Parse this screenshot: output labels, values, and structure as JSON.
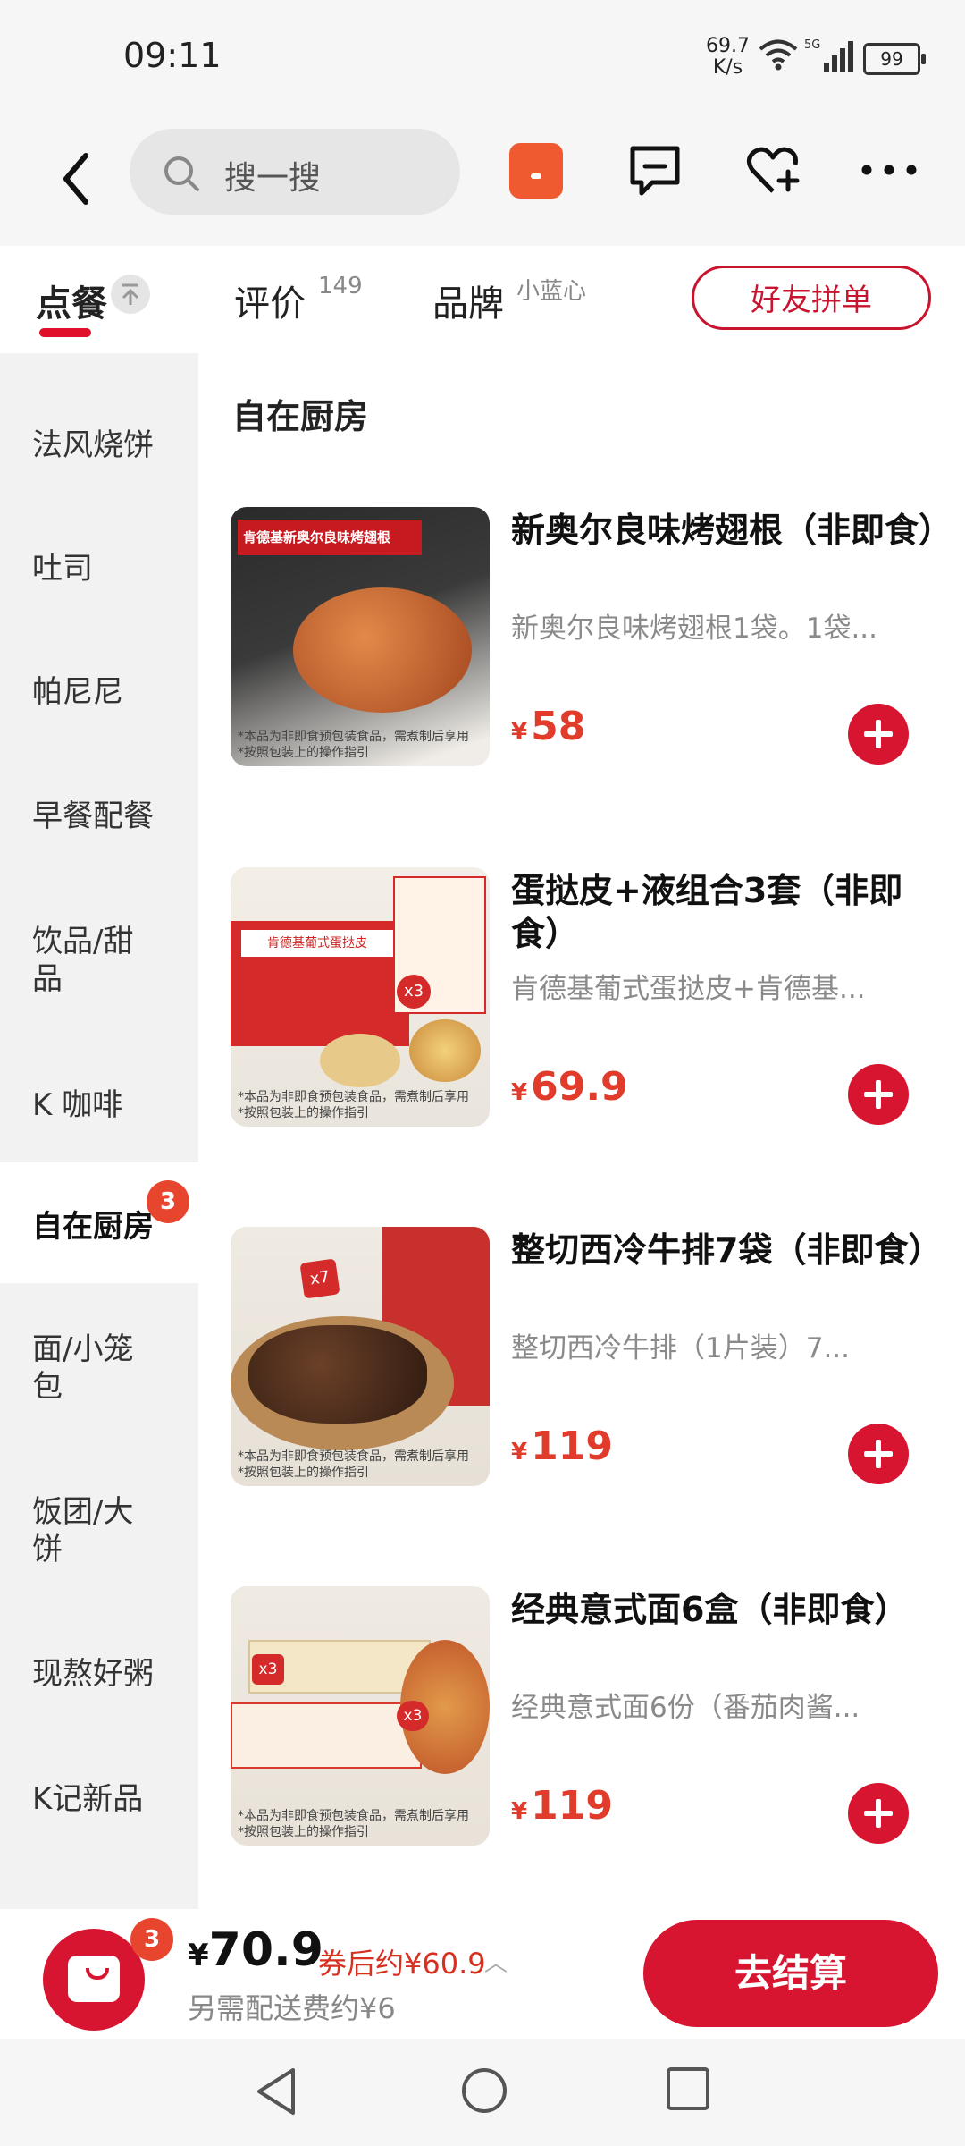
{
  "status": {
    "time": "09:11",
    "speed_value": "69.7",
    "speed_unit": "K/s",
    "network": "5G",
    "battery": "99"
  },
  "header": {
    "search_placeholder": "搜一搜"
  },
  "tabs": [
    {
      "label": "点餐",
      "active": true
    },
    {
      "label": "评价",
      "count": "149"
    },
    {
      "label": "品牌",
      "sub": "小蓝心"
    }
  ],
  "group_order_button": "好友拼单",
  "sidebar": {
    "categories": [
      "法风烧饼",
      "吐司",
      "帕尼尼",
      "早餐配餐",
      "饮品/甜品",
      "K 咖啡",
      "自在厨房",
      "面/小笼包",
      "饭团/大饼",
      "现熬好粥",
      "K记新品"
    ],
    "active_index": 6,
    "active_badge": "3"
  },
  "section_title": "自在厨房",
  "products": [
    {
      "name": "新奥尔良味烤翅根（非即食）",
      "desc": "新奥尔良味烤翅根1袋。1袋...",
      "currency": "¥",
      "price": "58",
      "image_title": "肯德基新奥尔良味烤翅根",
      "image_note": "*本品为非即食预包装食品，需煮制后享用",
      "image_note2": "*按照包装上的操作指引"
    },
    {
      "name": "蛋挞皮+液组合3套（非即食）",
      "desc": "肯德基葡式蛋挞皮+肯德基...",
      "currency": "¥",
      "price": "69.9",
      "image_title": "肯德基葡式蛋挞皮",
      "image_badge": "x3",
      "image_note": "*本品为非即食预包装食品，需煮制后享用",
      "image_note2": "*按照包装上的操作指引"
    },
    {
      "name": "整切西冷牛排7袋（非即食）",
      "desc": "整切西冷牛排（1片装）7...",
      "currency": "¥",
      "price": "119",
      "image_badge": "x7",
      "image_note": "*本品为非即食预包装食品，需煮制后享用",
      "image_note2": "*按照包装上的操作指引"
    },
    {
      "name": "经典意式面6盒（非即食）",
      "desc": "经典意式面6份（番茄肉酱...",
      "currency": "¥",
      "price": "119",
      "image_badge": "x3",
      "image_badge2": "x3",
      "image_note": "*本品为非即食预包装食品，需煮制后享用",
      "image_note2": "*按照包装上的操作指引"
    }
  ],
  "cart": {
    "badge": "3",
    "currency": "¥",
    "total": "70.9",
    "after_coupon": "券后约¥60.9",
    "shipping_note": "另需配送费约¥6",
    "checkout_label": "去结算"
  },
  "colors": {
    "accent": "#d81530",
    "price": "#e03b2b",
    "badge": "#e8452f"
  }
}
